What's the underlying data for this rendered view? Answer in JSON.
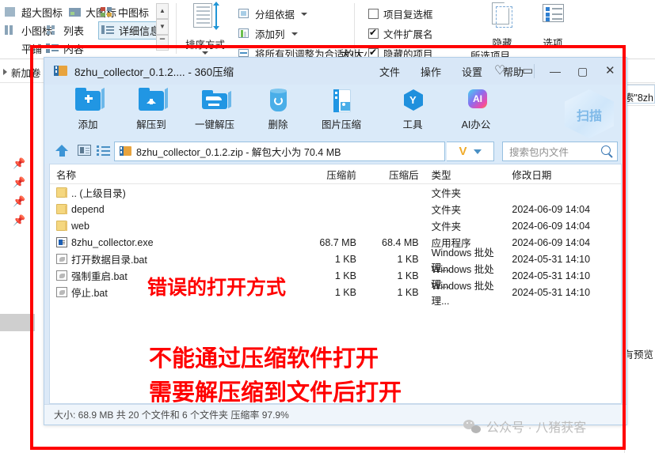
{
  "background_ribbon": {
    "view_items": [
      {
        "label": "超大图标",
        "icon": "extra-large-icons-icon",
        "selected": false
      },
      {
        "label": "大图标",
        "icon": "large-icons-icon",
        "selected": false
      },
      {
        "label": "中图标",
        "icon": "medium-icons-icon",
        "selected": false
      },
      {
        "label": "小图标",
        "icon": "small-icons-icon",
        "selected": false
      },
      {
        "label": "列表",
        "icon": "list-view-icon",
        "selected": false
      },
      {
        "label": "详细信息",
        "icon": "details-view-icon",
        "selected": true
      },
      {
        "label": "平铺",
        "icon": "tiles-view-icon",
        "selected": false
      },
      {
        "label": "内容",
        "icon": "content-view-icon",
        "selected": false
      }
    ],
    "spinner": {
      "up": "▲",
      "down": "▼",
      "more": "▔"
    },
    "sort_button": {
      "label": "排序方式",
      "icon": "sort-by-icon"
    },
    "group_by": {
      "label": "分组依据",
      "icon": "group-by-icon"
    },
    "add_column": {
      "label": "添加列",
      "icon": "add-column-icon"
    },
    "size_all_columns": {
      "label": "将所有列调整为合适的大小",
      "icon": "fit-columns-icon"
    },
    "size_text": "大小",
    "checkboxes": [
      {
        "label": "项目复选框",
        "checked": false
      },
      {
        "label": "文件扩展名",
        "checked": true
      },
      {
        "label": "隐藏的项目",
        "checked": true
      }
    ],
    "selected_items_label": "所选项目",
    "hide_button": {
      "label": "隐藏",
      "icon": "hide-selected-icon"
    },
    "options_button": {
      "label": "选项",
      "icon": "options-icon"
    }
  },
  "background_explorer": {
    "breadcrumb": "新加卷 (",
    "right_search_text": "索\"8zh",
    "right_preview_text": "有预览"
  },
  "zip_window": {
    "title": "8zhu_collector_0.1.2.... - 360压缩",
    "title_icon": "archive-icon",
    "menus": [
      "文件",
      "操作",
      "设置",
      "帮助"
    ],
    "window_icons": [
      {
        "name": "skin-icon",
        "glyph": "♡"
      },
      {
        "name": "feedback-icon",
        "glyph": "▭"
      },
      {
        "name": "minimize-icon",
        "glyph": "—"
      },
      {
        "name": "maximize-icon",
        "glyph": "▢"
      },
      {
        "name": "close-icon",
        "glyph": "✕"
      }
    ],
    "toolbar": [
      {
        "label": "添加",
        "icon": "add-to-archive-icon"
      },
      {
        "label": "解压到",
        "icon": "extract-to-icon"
      },
      {
        "label": "一键解压",
        "icon": "one-click-extract-icon"
      },
      {
        "label": "删除",
        "icon": "delete-icon"
      },
      {
        "label": "图片压缩",
        "icon": "image-compress-icon"
      },
      {
        "label": "工具",
        "icon": "tools-icon"
      },
      {
        "label": "AI办公",
        "icon": "ai-office-icon"
      }
    ],
    "scan_button": {
      "label": "扫描",
      "icon": "scan-icon"
    },
    "path_bar": {
      "up_icon": "up-arrow-icon",
      "view_icon": "view-mode-icon",
      "list_icon": "list-mode-icon",
      "path_text": "8zhu_collector_0.1.2.zip - 解包大小为 70.4 MB",
      "path_icon": "archive-icon",
      "v_button_label": "V",
      "search_placeholder": "搜索包内文件",
      "search_icon": "search-icon"
    },
    "columns": [
      "名称",
      "压缩前",
      "压缩后",
      "类型",
      "修改日期"
    ],
    "rows": [
      {
        "name": ".. (上级目录)",
        "icon": "folder-icon",
        "before": "",
        "after": "",
        "type": "文件夹",
        "date": ""
      },
      {
        "name": "depend",
        "icon": "folder-icon",
        "before": "",
        "after": "",
        "type": "文件夹",
        "date": "2024-06-09 14:04"
      },
      {
        "name": "web",
        "icon": "folder-icon",
        "before": "",
        "after": "",
        "type": "文件夹",
        "date": "2024-06-09 14:04"
      },
      {
        "name": "8zhu_collector.exe",
        "icon": "exe-icon",
        "before": "68.7 MB",
        "after": "68.4 MB",
        "type": "应用程序",
        "date": "2024-06-09 14:04"
      },
      {
        "name": "打开数据目录.bat",
        "icon": "bat-icon",
        "before": "1 KB",
        "after": "1 KB",
        "type": "Windows 批处理...",
        "date": "2024-05-31 14:10"
      },
      {
        "name": "强制重启.bat",
        "icon": "bat-icon",
        "before": "1 KB",
        "after": "1 KB",
        "type": "Windows 批处理...",
        "date": "2024-05-31 14:10"
      },
      {
        "name": "停止.bat",
        "icon": "bat-icon",
        "before": "1 KB",
        "after": "1 KB",
        "type": "Windows 批处理...",
        "date": "2024-05-31 14:10"
      }
    ],
    "status_text": "大小: 68.9 MB 共 20 个文件和 6 个文件夹 压缩率 97.9%"
  },
  "annotations": {
    "line_wrong_way": "错误的打开方式",
    "line_cannot_open": "不能通过压缩软件打开",
    "line_must_extract": "需要解压缩到文件后打开",
    "border_color": "#ff0000"
  },
  "watermark": {
    "text": "公众号 · 八猪获客",
    "icon": "wechat-icon"
  }
}
